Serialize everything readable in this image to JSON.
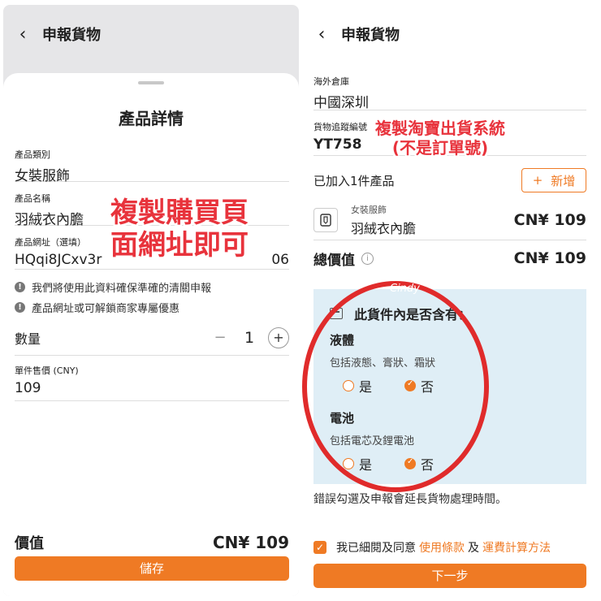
{
  "left": {
    "header": {
      "back_icon": "chevron-left-icon",
      "title": "申報貨物"
    },
    "sheet": {
      "title": "產品詳情",
      "category": {
        "label": "產品類別",
        "value": "女裝服飾"
      },
      "name": {
        "label": "產品名稱",
        "value": "羽絨衣內膽"
      },
      "url": {
        "label": "產品網址（選填）",
        "value": "HQqi8JCxv3r",
        "value_end": "06"
      },
      "notes": [
        "我們將使用此資料確保準確的清關申報",
        "產品網址或可解鎖商家專屬優惠"
      ],
      "quantity": {
        "label": "數量",
        "minus": "−",
        "value": "1",
        "plus": "+"
      },
      "unit_price": {
        "label": "單件售價 (CNY)",
        "value": "109"
      },
      "price": {
        "label": "價值",
        "value": "CN¥ 109"
      },
      "save_button": "儲存"
    },
    "overlay": {
      "line1": "複製購買頁",
      "line2": "面網址即可"
    }
  },
  "right": {
    "header": {
      "back_icon": "chevron-left-icon",
      "title": "申報貨物"
    },
    "warehouse": {
      "label": "海外倉庫",
      "value": "中國深圳"
    },
    "tracking": {
      "label": "貨物追蹤編號",
      "value": "YT758"
    },
    "overlay": {
      "line1": "複製淘寶出貨系統",
      "line2": "(不是訂單號)"
    },
    "added": {
      "label": "已加入1件產品",
      "add_plus": "+",
      "add_label": "新增"
    },
    "item": {
      "category": "女裝服飾",
      "name": "羽絨衣內膽",
      "price": "CN¥ 109"
    },
    "total": {
      "label": "總價值",
      "help": "i",
      "value": "CN¥ 109"
    },
    "contains": {
      "title": "此貨件內是否含有：",
      "liquid": {
        "label": "液體",
        "desc": "包括液態、膏狀、霜狀",
        "yes": "是",
        "no": "否",
        "selected": "no"
      },
      "battery": {
        "label": "電池",
        "desc": "包括電芯及鋰電池",
        "yes": "是",
        "no": "否",
        "selected": "no"
      }
    },
    "watermark": "Cindy",
    "warning": "錯誤勾選及申報會延長貨物處理時間。",
    "agree": {
      "prefix": "我已細閱及同意",
      "terms": "使用條款",
      "and": "及",
      "shipping": "運費計算方法"
    },
    "next_button": "下一步"
  },
  "colors": {
    "accent": "#ef7a24",
    "annotation_red": "#e8333c",
    "info_box": "#dfeef6"
  }
}
